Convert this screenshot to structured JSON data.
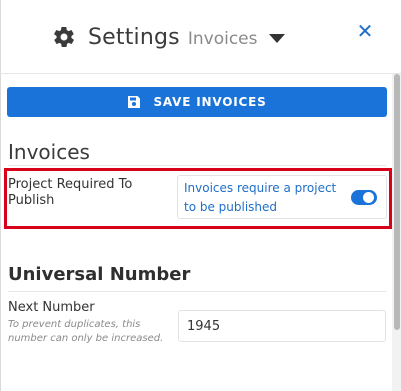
{
  "header": {
    "title": "Settings",
    "subtitle": "Invoices",
    "icons": {
      "gear": "gear-icon",
      "caret": "chevron-down-icon",
      "close": "close-icon"
    },
    "close_glyph": "✕"
  },
  "toolbar": {
    "save_label": "SAVE INVOICES",
    "save_icon": "floppy-disk-icon"
  },
  "sections": {
    "invoices": {
      "title": "Invoices",
      "project_required": {
        "label": "Project Required To Publish",
        "description": "Invoices require a project to be published",
        "enabled": true
      }
    },
    "universal_number": {
      "title": "Universal Number",
      "next_number": {
        "label": "Next Number",
        "hint": "To prevent duplicates, this number can only be increased.",
        "value": "1945"
      }
    }
  },
  "colors": {
    "accent": "#1a73d9",
    "link": "#1f6fc8",
    "highlight_border": "#d9001b"
  }
}
